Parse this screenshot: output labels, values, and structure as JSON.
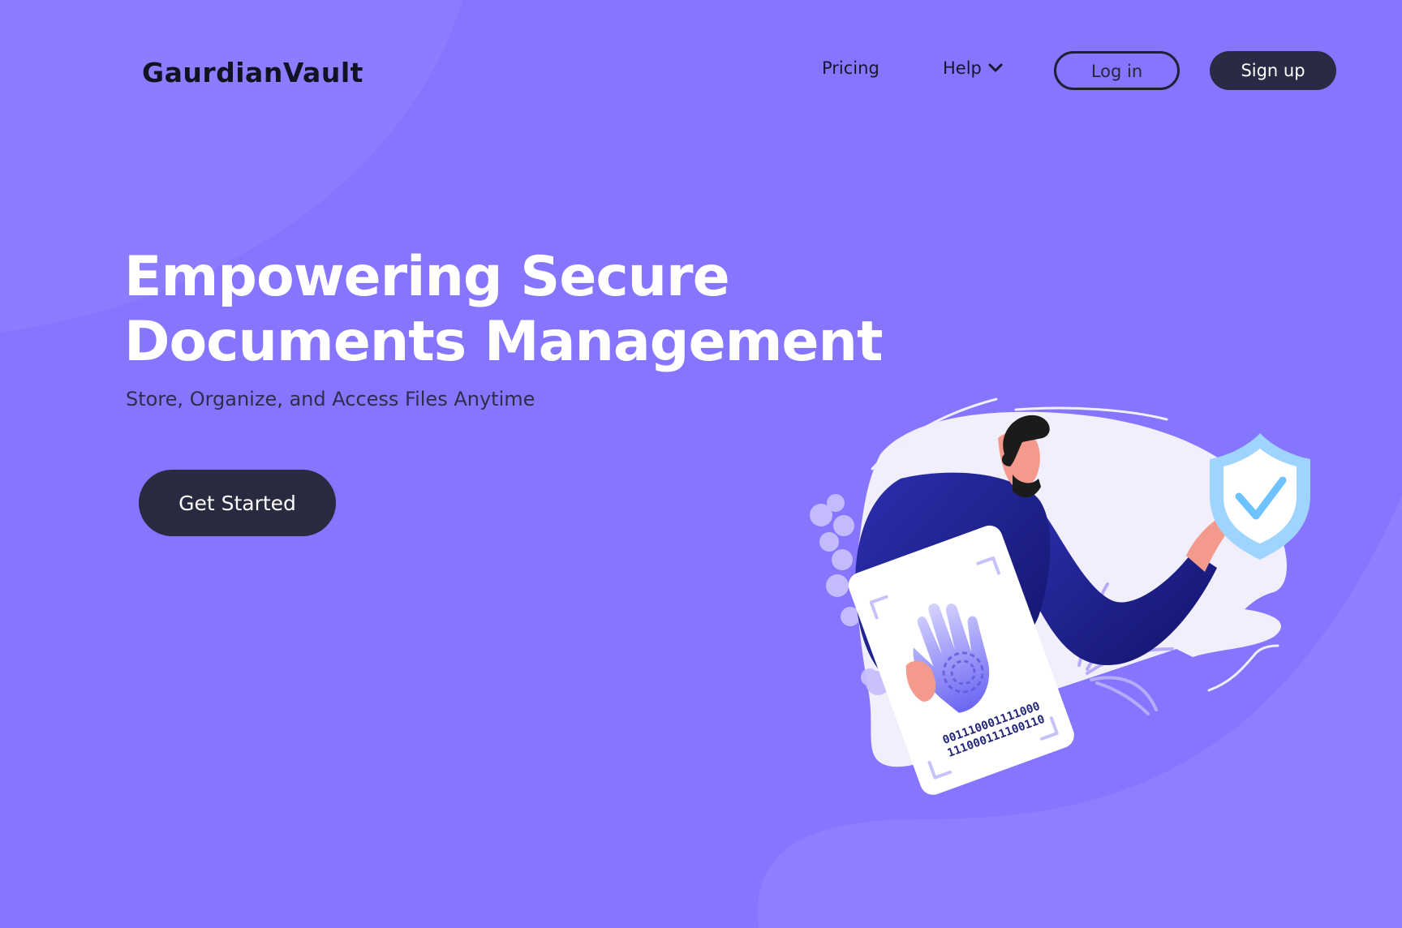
{
  "brand": {
    "name": "GaurdianVault"
  },
  "nav": {
    "pricing_label": "Pricing",
    "help_label": "Help",
    "login_label": "Log in",
    "signup_label": "Sign up"
  },
  "hero": {
    "title_line1": "Empowering Secure",
    "title_line2": "Documents Management",
    "subtitle": "Store, Organize, and Access Files Anytime",
    "cta_label": "Get Started"
  },
  "illustration": {
    "binary_line1": "001110001111000",
    "binary_line2": "111000111100110"
  },
  "colors": {
    "background": "#8675FE",
    "dark_button": "#2A2A45",
    "title_text": "#FFFFFF",
    "subtitle_text": "#2E2E4A",
    "shield": "#9FD4FF",
    "figure_body": "#1F238F"
  },
  "icons": {
    "help_dropdown": "chevron-down-icon",
    "shield": "shield-check-icon",
    "document": "fingerprint-document-icon"
  }
}
